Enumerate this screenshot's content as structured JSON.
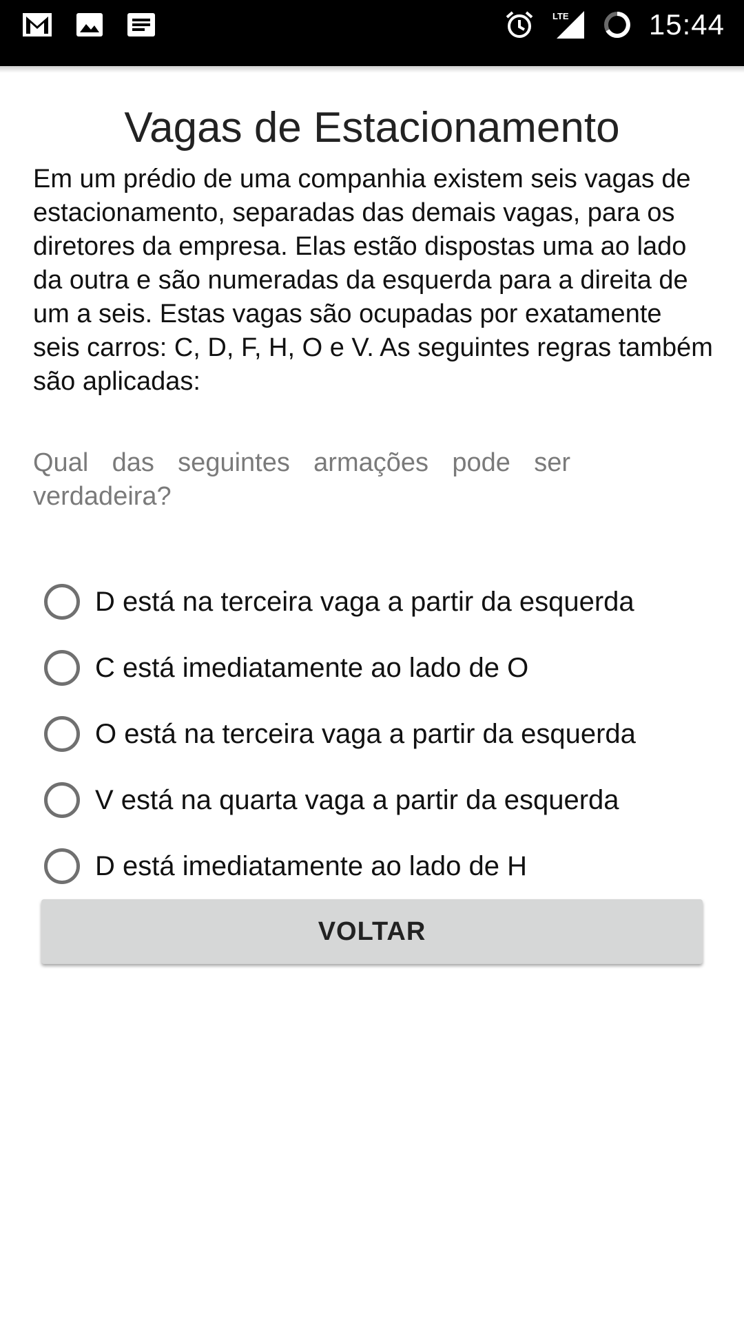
{
  "status_bar": {
    "left_icons": [
      "gmail-icon",
      "gallery-icon",
      "message-icon"
    ],
    "right_icons": [
      "alarm-icon",
      "lte-signal-icon",
      "battery-loading-icon"
    ],
    "network_label": "LTE",
    "time": "15:44"
  },
  "page": {
    "title": "Vagas de Estacionamento",
    "description": "Em um prédio de uma companhia existem seis vagas de estacionamento, separadas das demais vagas, para os diretores da empresa. Elas estão dispostas uma ao lado da outra e são numeradas da esquerda para a direita de um a seis. Estas vagas são ocupadas por exatamente seis carros: C, D, F, H, O e V. As seguintes regras também são aplicadas:",
    "question": "Qual das seguintes armações pode ser verdadeira?"
  },
  "options": [
    {
      "label": "D está na terceira vaga a partir da esquerda",
      "selected": false
    },
    {
      "label": "C está imediatamente ao lado de O",
      "selected": false
    },
    {
      "label": "O está na terceira vaga a partir da esquerda",
      "selected": false
    },
    {
      "label": "V está na quarta vaga a partir da esquerda",
      "selected": false
    },
    {
      "label": "D está imediatamente ao lado de H",
      "selected": false
    }
  ],
  "back_button": {
    "label": "VOLTAR"
  },
  "colors": {
    "status_bar_bg": "#000000",
    "button_bg": "#d6d7d7",
    "question_text": "#7a7a7a",
    "radio_ring": "#707070"
  }
}
